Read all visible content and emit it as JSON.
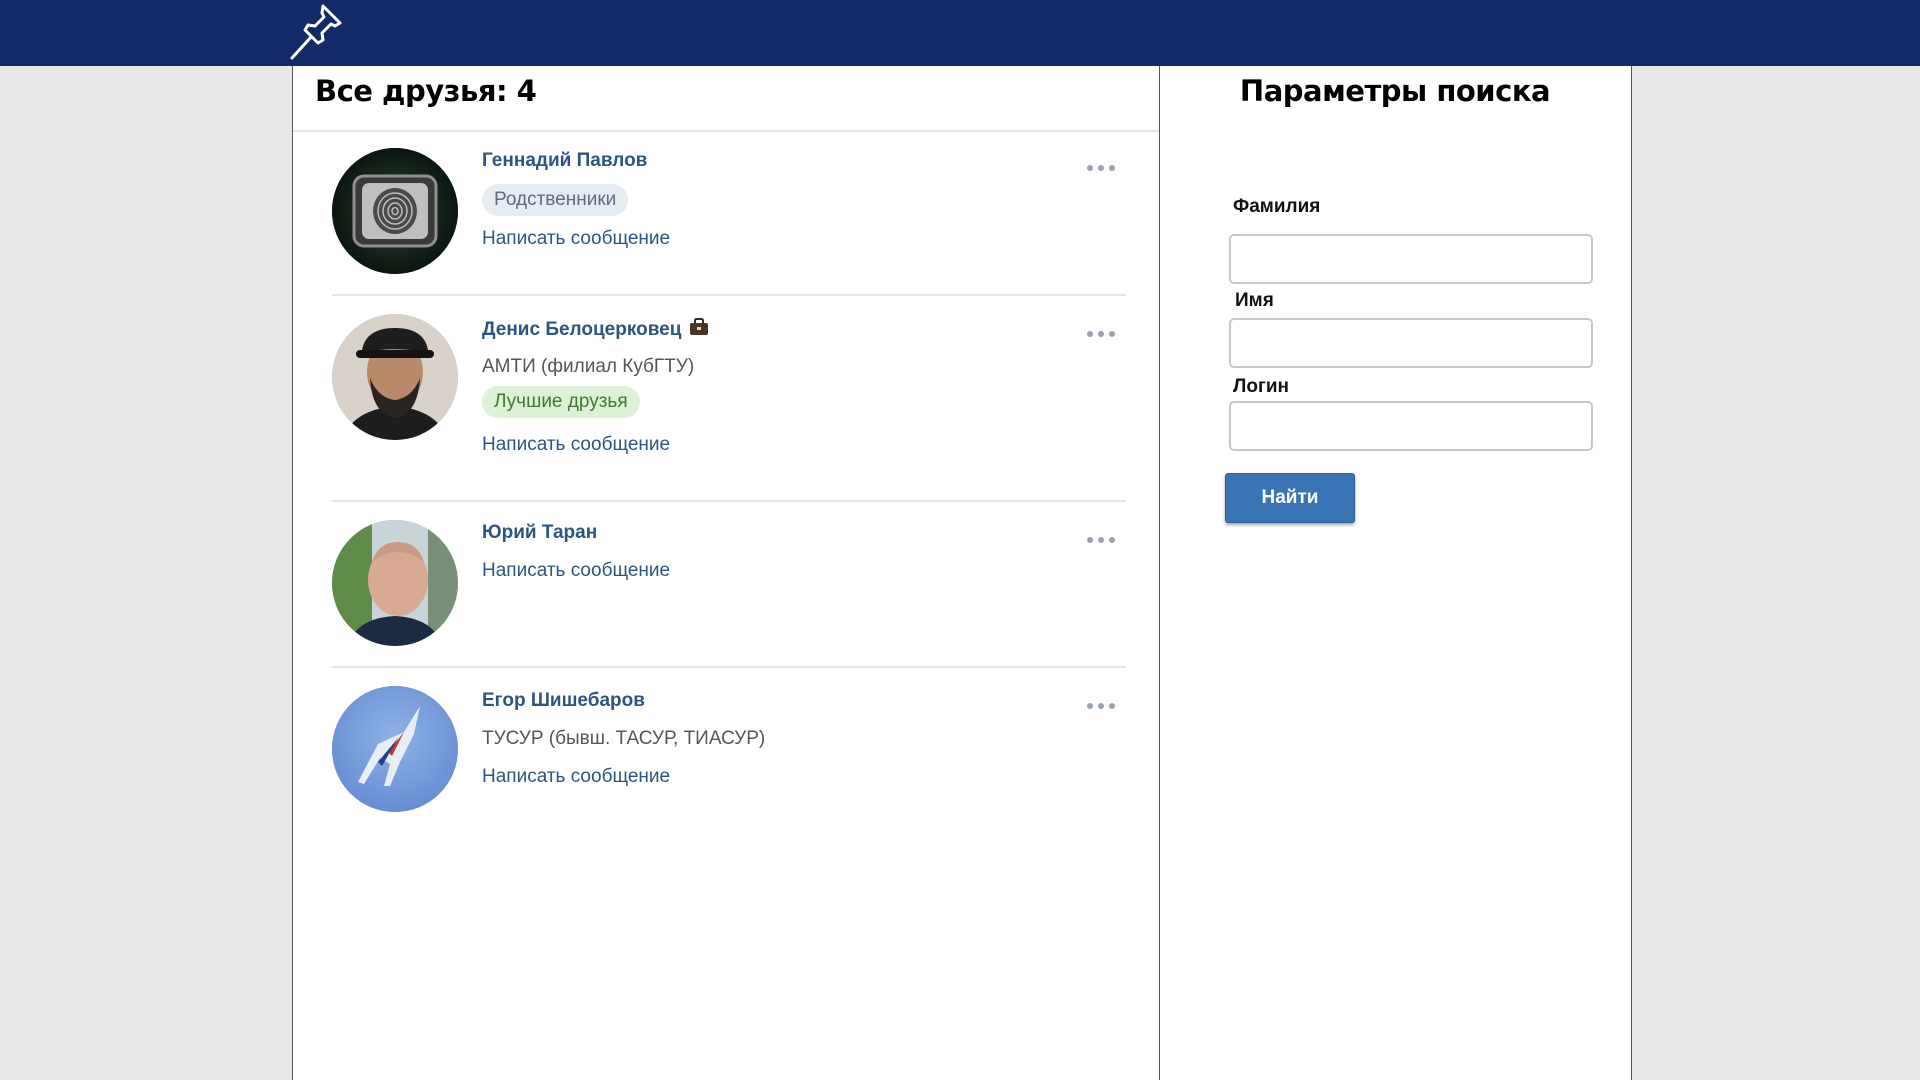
{
  "header": {
    "logo_icon": "pushpin-icon",
    "background": "#142a68"
  },
  "friends": {
    "title": "Все друзья: 4",
    "items": [
      {
        "name": "Геннадий Павлов",
        "subtitle": "",
        "tag": "Родственники",
        "tag_style": "gray",
        "message_link": "Написать сообщение",
        "avatar_icon": "fingerprint-avatar"
      },
      {
        "name": "Денис Белоцерковец",
        "name_icon": "briefcase-icon",
        "subtitle": "АМТИ (филиал КубГТУ)",
        "tag": "Лучшие друзья",
        "tag_style": "green",
        "message_link": "Написать сообщение",
        "avatar_icon": "person-photo-avatar"
      },
      {
        "name": "Юрий Таран",
        "subtitle": "",
        "tag": "",
        "message_link": "Написать сообщение",
        "avatar_icon": "person-photo-avatar"
      },
      {
        "name": "Егор Шишебаров",
        "subtitle": "ТУСУР (бывш. ТАСУР, ТИАСУР)",
        "tag": "",
        "message_link": "Написать сообщение",
        "avatar_icon": "jet-photo-avatar"
      }
    ]
  },
  "search": {
    "title": "Параметры поиска",
    "fields": {
      "surname_label": "Фамилия",
      "surname_value": "",
      "name_label": "Имя",
      "name_value": "",
      "login_label": "Логин",
      "login_value": ""
    },
    "submit_label": "Найти",
    "accent": "#3a74b4"
  }
}
